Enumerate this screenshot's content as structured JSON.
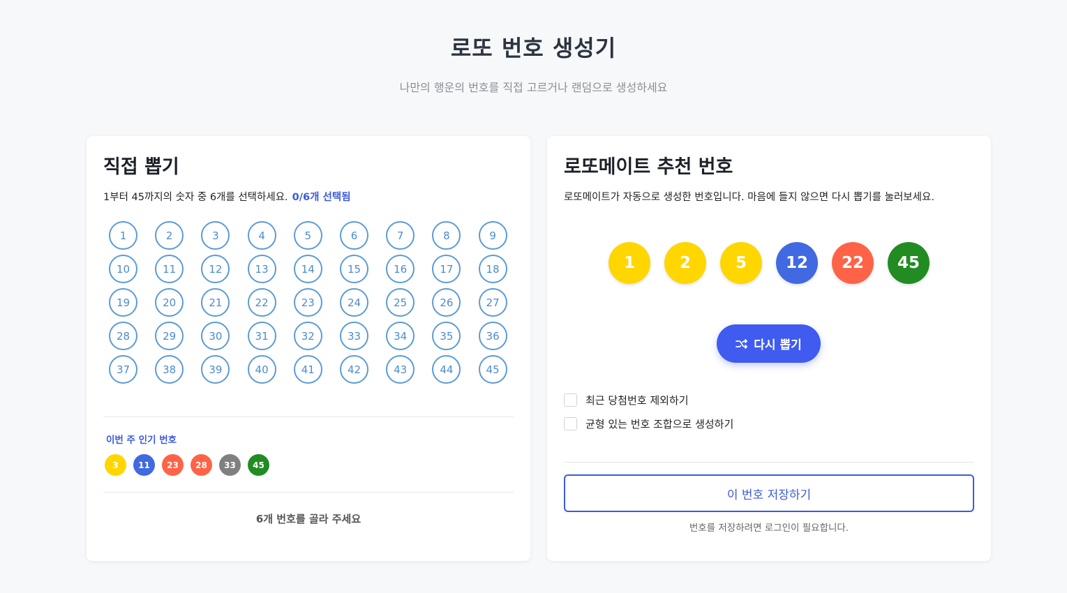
{
  "header": {
    "title": "로또 번호 생성기",
    "subtitle": "나만의 행운의 번호를 직접 고르거나 랜덤으로 생성하세요"
  },
  "manual": {
    "title": "직접 뽑기",
    "description": "1부터 45까지의 숫자 중 6개를 선택하세요.",
    "selected_count": "0/6개 선택됨",
    "numbers": [
      "1",
      "2",
      "3",
      "4",
      "5",
      "6",
      "7",
      "8",
      "9",
      "10",
      "11",
      "12",
      "13",
      "14",
      "15",
      "16",
      "17",
      "18",
      "19",
      "20",
      "21",
      "22",
      "23",
      "24",
      "25",
      "26",
      "27",
      "28",
      "29",
      "30",
      "31",
      "32",
      "33",
      "34",
      "35",
      "36",
      "37",
      "38",
      "39",
      "40",
      "41",
      "42",
      "43",
      "44",
      "45"
    ],
    "popular_label": "이번 주 인기 번호",
    "popular": [
      {
        "n": "3",
        "color": "#ffd600",
        "text": "#ffffff"
      },
      {
        "n": "11",
        "color": "#4169e1",
        "text": "#ffffff"
      },
      {
        "n": "23",
        "color": "#ff6347",
        "text": "#ffffff"
      },
      {
        "n": "28",
        "color": "#ff6347",
        "text": "#ffffff"
      },
      {
        "n": "33",
        "color": "#808080",
        "text": "#ffffff"
      },
      {
        "n": "45",
        "color": "#228b22",
        "text": "#ffffff"
      }
    ],
    "status": "6개 번호를 골라 주세요"
  },
  "recommend": {
    "title": "로또메이트 추천 번호",
    "description": "로또메이트가 자동으로 생성한 번호입니다. 마음에 들지 않으면 다시 뽑기를 눌러보세요.",
    "balls": [
      {
        "n": "1",
        "color": "#ffd600"
      },
      {
        "n": "2",
        "color": "#ffd600"
      },
      {
        "n": "5",
        "color": "#ffd600"
      },
      {
        "n": "12",
        "color": "#4169e1"
      },
      {
        "n": "22",
        "color": "#ff6347"
      },
      {
        "n": "45",
        "color": "#228b22"
      }
    ],
    "redraw_label": "다시 뽑기",
    "options": [
      {
        "label": "최근 당첨번호 제외하기",
        "checked": false
      },
      {
        "label": "균형 있는 번호 조합으로 생성하기",
        "checked": false
      }
    ],
    "save_label": "이 번호 저장하기",
    "login_note": "번호를 저장하려면 로그인이 필요합니다."
  },
  "colors": {
    "accent": "#3b5bdb",
    "button": "#3f5bf0",
    "number_outline": "#5b9bd5"
  }
}
